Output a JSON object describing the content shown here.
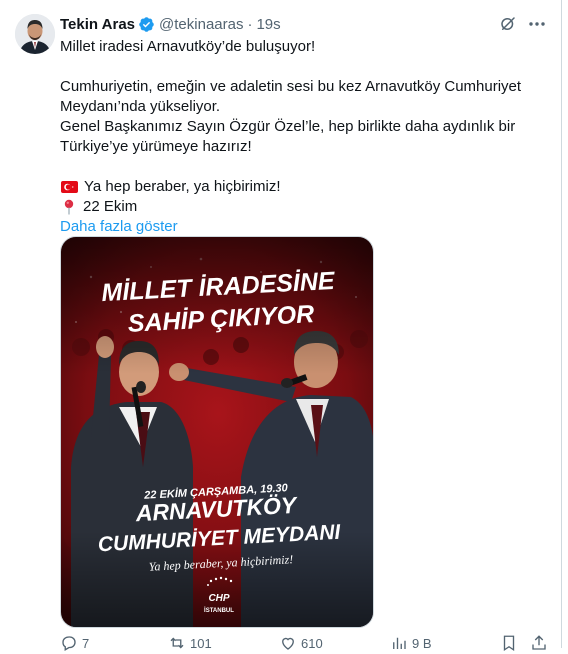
{
  "user": {
    "name": "Tekin Aras",
    "handle": "@tekinaaras",
    "separator": "·",
    "time": "19s"
  },
  "tweet": {
    "line1": "Millet iradesi Arnavutköy’de buluşuyor!",
    "para2_line1": "Cumhuriyetin, emeğin ve adaletin sesi bu kez Arnavutköy Cumhuriyet",
    "para2_line2": "Meydanı’nda yükseliyor.",
    "para2_line3": "Genel Başkanımız Sayın Özgür Özel’le, hep birlikte daha aydınlık bir",
    "para2_line4": "Türkiye’ye yürümeye hazırız!",
    "slogan": "Ya hep beraber, ya hiçbirimiz!",
    "date": "22 Ekim",
    "show_more": "Daha fazla göster"
  },
  "poster": {
    "headline1": "MİLLET İRADESİNE",
    "headline2": "SAHİP ÇIKIYOR",
    "event_datetime": "22 EKİM ÇARŞAMBA, 19.30",
    "venue1": "ARNAVUTKÖY",
    "venue2": "CUMHURİYET MEYDANI",
    "slogan": "Ya hep beraber, ya hiçbirimiz!",
    "logo_text": "CHP",
    "logo_sub": "İSTANBUL",
    "colors": {
      "bg": "#8e1013",
      "bg_dark": "#3a0608",
      "text": "#ffffff"
    }
  },
  "actions": {
    "replies": "7",
    "reposts": "101",
    "likes": "610",
    "views": "9 B"
  },
  "colors": {
    "link": "#1d9bf0",
    "secondary": "#536471",
    "verified": "#1d9bf0"
  }
}
